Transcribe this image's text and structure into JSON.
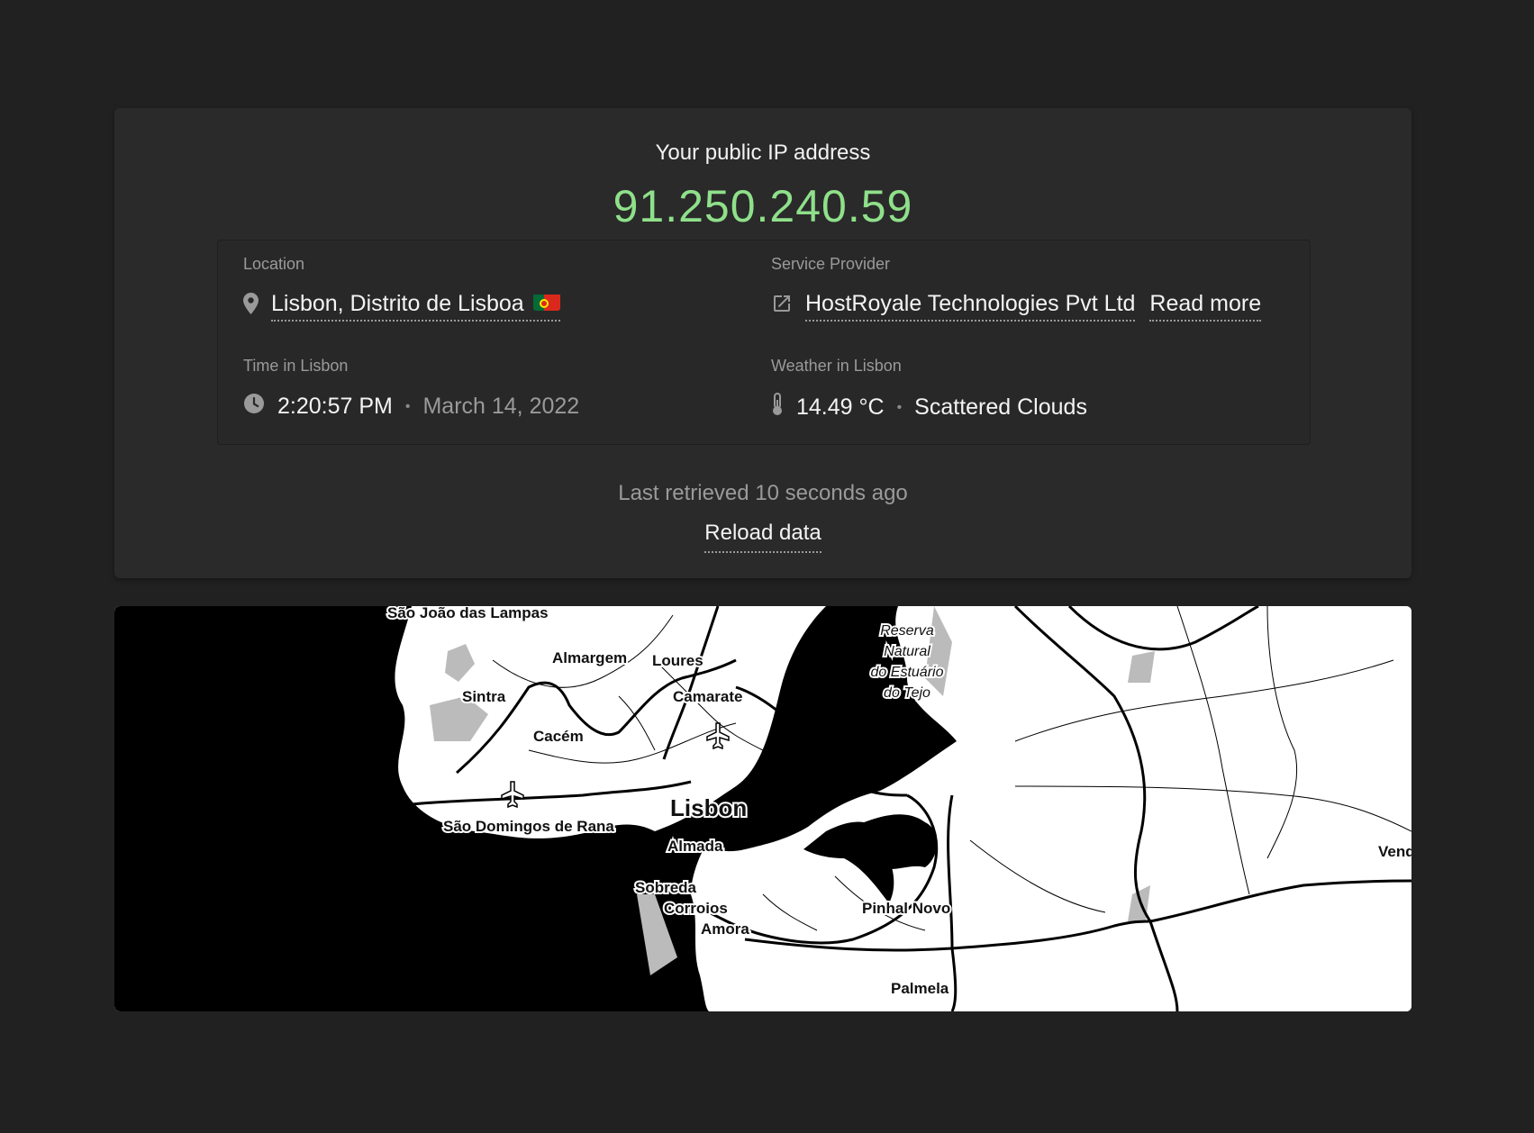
{
  "header": {
    "title": "Your public IP address",
    "ip": "91.250.240.59"
  },
  "location": {
    "label": "Location",
    "value": "Lisbon, Distrito de Lisboa",
    "flag": "Portugal flag",
    "icon": "map-pin-icon"
  },
  "provider": {
    "label": "Service Provider",
    "value": "HostRoyale Technologies Pvt Ltd",
    "read_more": "Read more",
    "icon": "external-link-icon"
  },
  "time": {
    "label": "Time in Lisbon",
    "clock": "2:20:57 PM",
    "date": "March 14, 2022",
    "icon": "clock-icon"
  },
  "weather": {
    "label": "Weather in Lisbon",
    "temp": "14.49 °C",
    "condition": "Scattered Clouds",
    "icon": "thermometer-icon"
  },
  "footer": {
    "retrieved": "Last retrieved 10 seconds ago",
    "reload": "Reload data"
  },
  "map": {
    "labels": {
      "sao_joao": "São João das Lampas",
      "almargem": "Almargem",
      "loures": "Loures",
      "sintra": "Sintra",
      "camarate": "Camarate",
      "cacem": "Cacém",
      "lisbon": "Lisbon",
      "sao_domingos": "São Domingos de Rana",
      "almada": "Almada",
      "sobreda": "Sobreda",
      "corroios": "Corroios",
      "amora": "Amora",
      "pinhal_novo": "Pinhal Novo",
      "palmela": "Palmela",
      "vend": "Vend",
      "reserva1": "Reserva",
      "reserva2": "Natural",
      "reserva3": "do Estuário",
      "reserva4": "do Tejo"
    }
  },
  "colors": {
    "background": "#212121",
    "card": "#2a2a2a",
    "ip": "#8fe08a",
    "muted": "#9a9a9a"
  }
}
